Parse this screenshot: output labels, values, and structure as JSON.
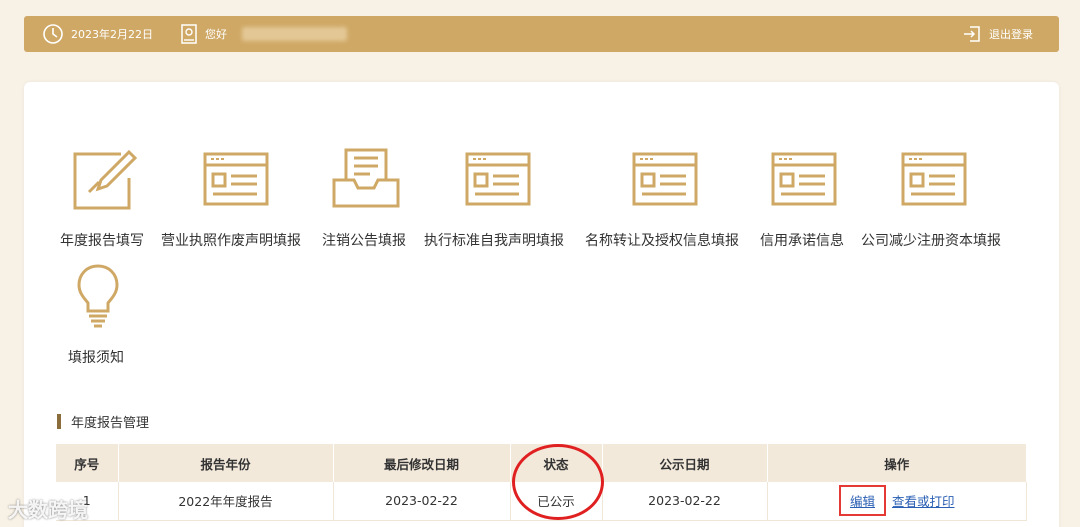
{
  "header": {
    "date": "2023年2月22日",
    "greeting": "您好",
    "logout": "退出登录"
  },
  "tiles": [
    {
      "label": "年度报告填写",
      "icon": "pencil-form-icon"
    },
    {
      "label": "营业执照作废声明填报",
      "icon": "form-window-icon"
    },
    {
      "label": "注销公告填报",
      "icon": "document-tray-icon"
    },
    {
      "label": "执行标准自我声明填报",
      "icon": "form-window-icon"
    },
    {
      "label": "名称转让及授权信息填报",
      "icon": "form-window-icon"
    },
    {
      "label": "信用承诺信息",
      "icon": "form-window-icon"
    },
    {
      "label": "公司减少注册资本填报",
      "icon": "form-window-icon"
    },
    {
      "label": "填报须知",
      "icon": "lightbulb-icon"
    }
  ],
  "section": {
    "title": "年度报告管理"
  },
  "table": {
    "headers": [
      "序号",
      "报告年份",
      "最后修改日期",
      "状态",
      "公示日期",
      "操作"
    ],
    "rows": [
      {
        "no": "1",
        "year": "2022年年度报告",
        "modified": "2023-02-22",
        "status": "已公示",
        "published": "2023-02-22",
        "edit": "编辑",
        "view": "查看或打印"
      }
    ]
  },
  "watermark": "大数跨境",
  "colors": {
    "gold": "#cfa865",
    "background": "#f7f1e6",
    "link": "#2a5fb3",
    "annotation": "#e02020"
  }
}
